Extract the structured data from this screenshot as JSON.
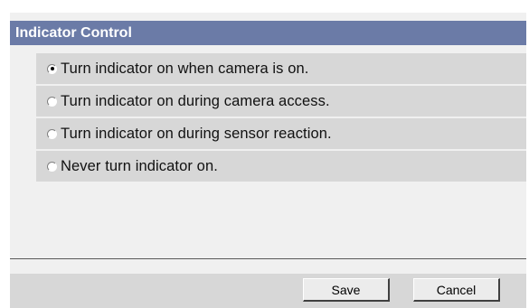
{
  "section": {
    "title": "Indicator Control"
  },
  "options": [
    {
      "label": "Turn indicator on when camera is on.",
      "checked": true
    },
    {
      "label": "Turn indicator on during camera access.",
      "checked": false
    },
    {
      "label": "Turn indicator on during sensor reaction.",
      "checked": false
    },
    {
      "label": "Never turn indicator on.",
      "checked": false
    }
  ],
  "buttons": {
    "save_label": "Save",
    "cancel_label": "Cancel"
  },
  "colors": {
    "header_bg": "#6b7ba7",
    "option_bg": "#d7d7d7",
    "panel_bg": "#f0f0f0"
  }
}
